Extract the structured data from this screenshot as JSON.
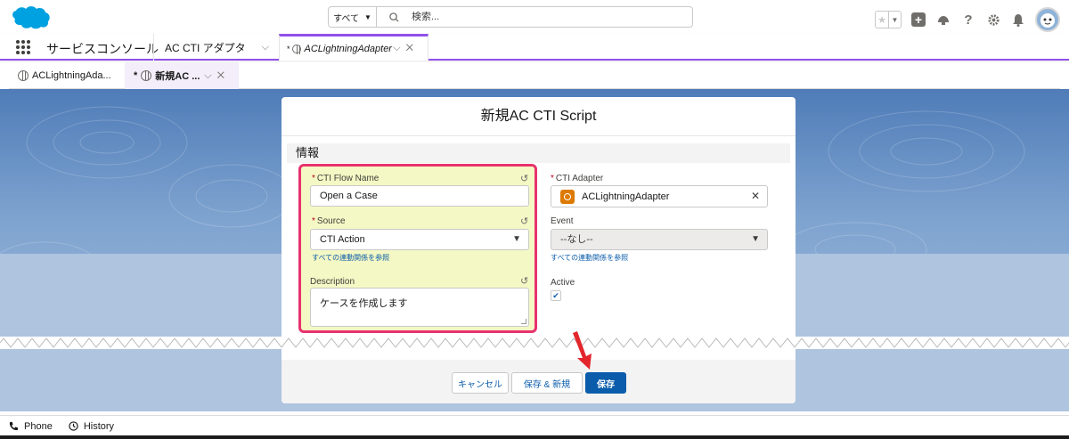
{
  "search": {
    "scope_label": "すべて",
    "placeholder": "検索..."
  },
  "app": {
    "name": "サービスコンソール"
  },
  "nav": {
    "object_tab": "AC CTI アダプタ",
    "active_tab": "ACLightningAdapter",
    "active_tab_prefix": "*"
  },
  "subtabs": [
    {
      "label": "ACLightningAda..."
    },
    {
      "label": "新規AC ...",
      "prefix": "*"
    }
  ],
  "modal": {
    "title": "新規AC CTI Script",
    "section": "情報",
    "fields": {
      "flow_name_label": "CTI Flow Name",
      "flow_name_value": "Open a Case",
      "source_label": "Source",
      "source_value": "CTI Action",
      "source_link": "すべての連動関係を参照",
      "description_label": "Description",
      "description_value": "ケースを作成します",
      "adapter_label": "CTI Adapter",
      "adapter_value": "ACLightningAdapter",
      "event_label": "Event",
      "event_value": "--なし--",
      "event_link": "すべての連動関係を参照",
      "active_label": "Active",
      "active_checked": true
    },
    "required_marker": "*",
    "buttons": {
      "cancel": "キャンセル",
      "save_new": "保存 & 新規",
      "save": "保存"
    }
  },
  "utility": {
    "phone": "Phone",
    "history": "History"
  },
  "colors": {
    "brand": "#0b5cab",
    "highlight_border": "#e8326e",
    "highlight_fill": "#f4f8c4",
    "nav_accent": "#9050e9",
    "arrow": "#e3262b"
  }
}
